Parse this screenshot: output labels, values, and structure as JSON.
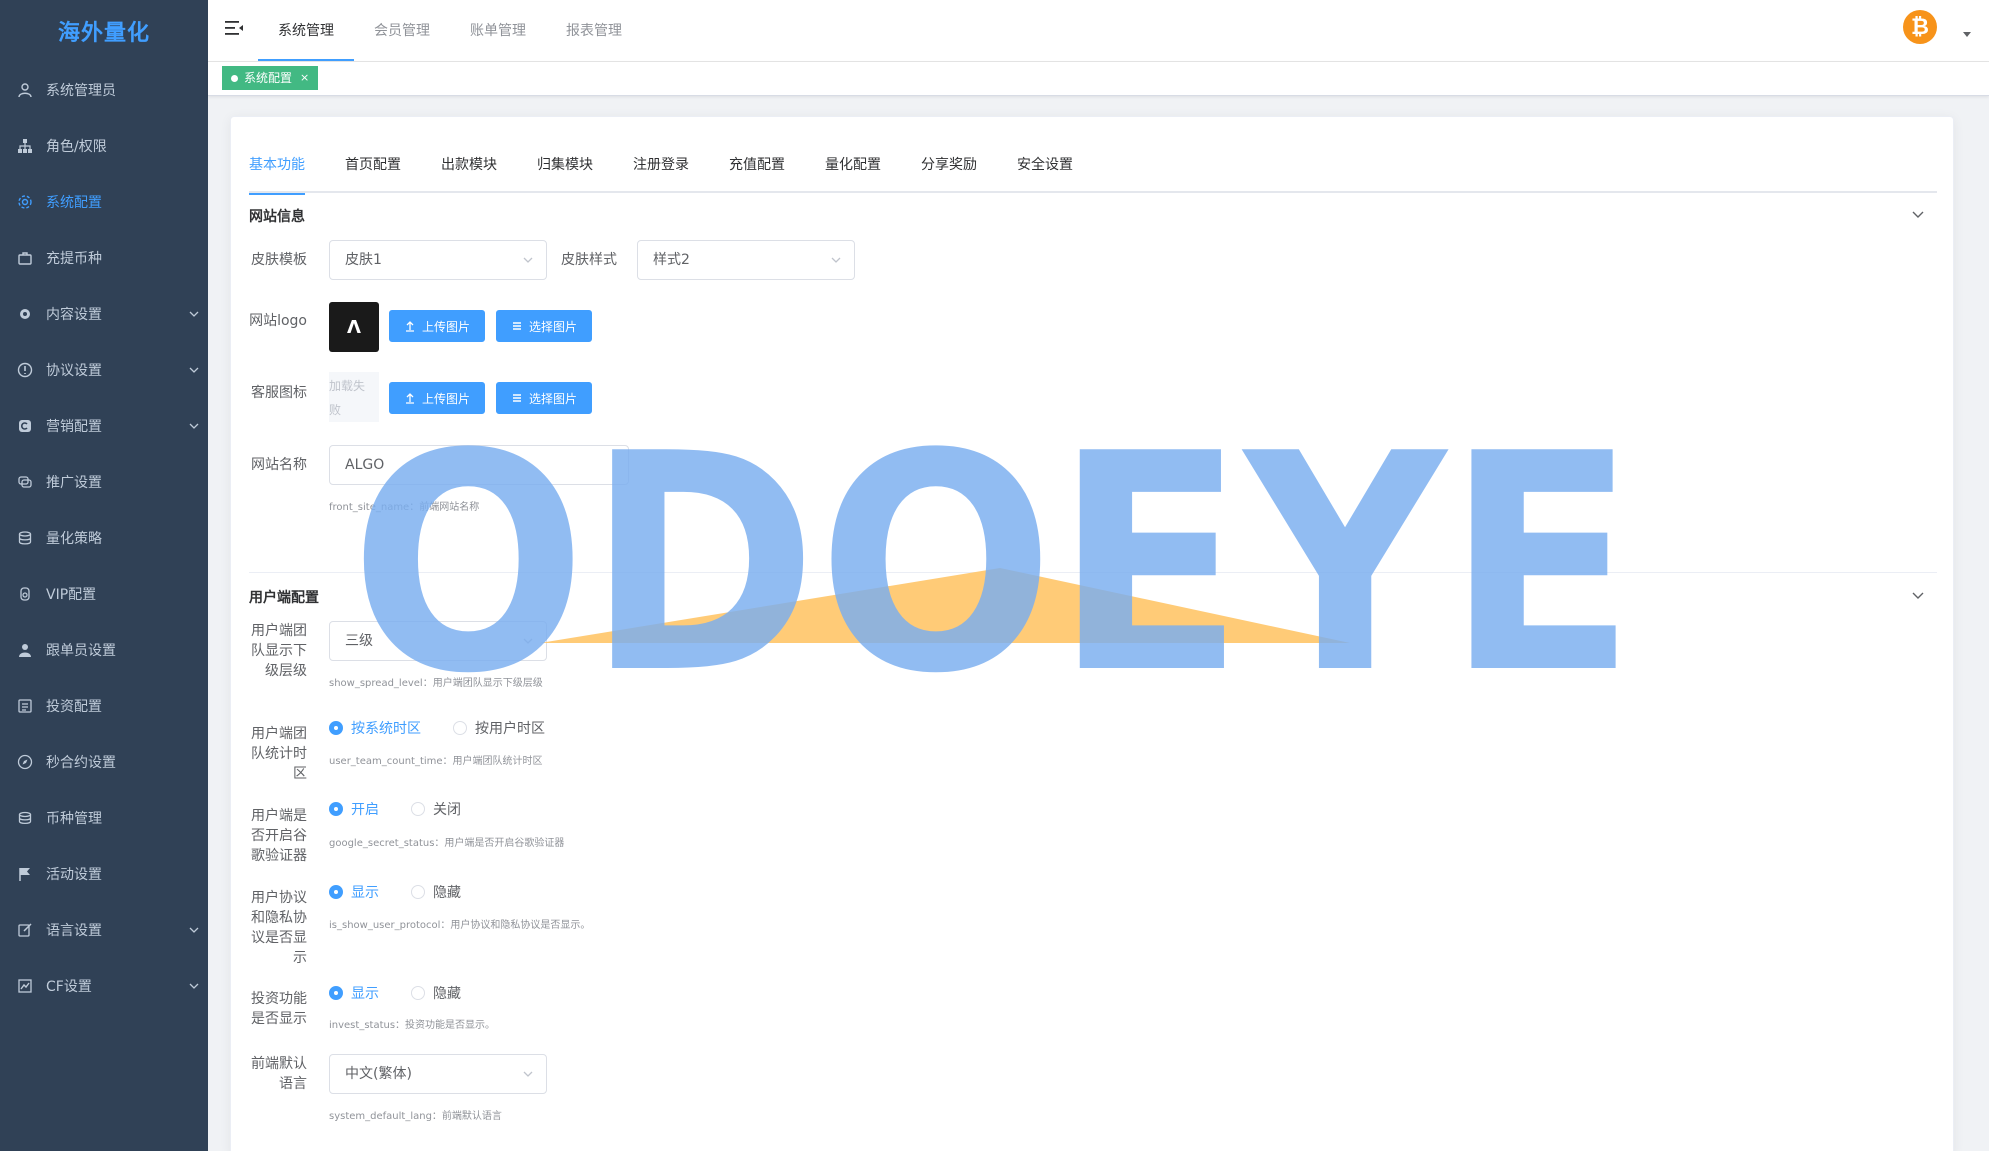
{
  "app": {
    "title": "海外量化"
  },
  "sidebar": {
    "items": [
      {
        "label": "系统管理员",
        "icon": "user-icon",
        "arrow": false,
        "active": false
      },
      {
        "label": "角色/权限",
        "icon": "sitemap-icon",
        "arrow": false,
        "active": false
      },
      {
        "label": "系统配置",
        "icon": "gear-icon",
        "arrow": false,
        "active": true
      },
      {
        "label": "充提币种",
        "icon": "briefcase-icon",
        "arrow": false,
        "active": false
      },
      {
        "label": "内容设置",
        "icon": "cog-icon",
        "arrow": true,
        "active": false
      },
      {
        "label": "协议设置",
        "icon": "info-icon",
        "arrow": true,
        "active": false
      },
      {
        "label": "营销配置",
        "icon": "marketing-icon",
        "arrow": true,
        "active": false
      },
      {
        "label": "推广设置",
        "icon": "chat-icon",
        "arrow": false,
        "active": false
      },
      {
        "label": "量化策略",
        "icon": "database-icon",
        "arrow": false,
        "active": false
      },
      {
        "label": "VIP配置",
        "icon": "medal-icon",
        "arrow": false,
        "active": false
      },
      {
        "label": "跟单员设置",
        "icon": "person-icon",
        "arrow": false,
        "active": false
      },
      {
        "label": "投资配置",
        "icon": "invest-icon",
        "arrow": false,
        "active": false
      },
      {
        "label": "秒合约设置",
        "icon": "compass-icon",
        "arrow": false,
        "active": false
      },
      {
        "label": "币种管理",
        "icon": "coins-icon",
        "arrow": false,
        "active": false
      },
      {
        "label": "活动设置",
        "icon": "flag-icon",
        "arrow": false,
        "active": false
      },
      {
        "label": "语言设置",
        "icon": "edit-icon",
        "arrow": true,
        "active": false
      },
      {
        "label": "CF设置",
        "icon": "chart-icon",
        "arrow": true,
        "active": false
      }
    ]
  },
  "header": {
    "tabs": [
      "系统管理",
      "会员管理",
      "账单管理",
      "报表管理"
    ],
    "active_tab": 0,
    "avatar_symbol": "₿",
    "avatar_color": "#f7931a"
  },
  "tags": {
    "active_label": "系统配置",
    "close": "×"
  },
  "config_tabs": [
    "基本功能",
    "首页配置",
    "出款模块",
    "归集模块",
    "注册登录",
    "充值配置",
    "量化配置",
    "分享奖励",
    "安全设置"
  ],
  "website_info": {
    "title": "网站信息",
    "skin_template_label": "皮肤模板",
    "skin_template_value": "皮肤1",
    "skin_style_label": "皮肤样式",
    "skin_style_value": "样式2",
    "logo_label": "网站logo",
    "logo_mark": "Λ",
    "upload_label": "上传图片",
    "choose_label": "选择图片",
    "service_icon_label": "客服图标",
    "service_icon_fail": [
      "加载失",
      "败"
    ],
    "site_name_label": "网站名称",
    "site_name_value": "ALGO",
    "site_name_hint": "front_site_name：前端网站名称"
  },
  "client_config": {
    "title": "用户端配置",
    "spread_level_label": [
      "用户端团",
      "队显示下",
      "级层级"
    ],
    "spread_level_value": "三级",
    "spread_level_hint": "show_spread_level：用户端团队显示下级层级",
    "count_time_label": [
      "用户端团",
      "队统计时",
      "区"
    ],
    "count_time_options": [
      "按系统时区",
      "按用户时区"
    ],
    "count_time_hint": "user_team_count_time：用户端团队统计时区",
    "google_label": [
      "用户端是",
      "否开启谷",
      "歌验证器"
    ],
    "google_options": [
      "开启",
      "关闭"
    ],
    "google_hint": "google_secret_status：用户端是否开启谷歌验证器",
    "protocol_label": [
      "用户协议",
      "和隐私协",
      "议是否显",
      "示"
    ],
    "protocol_options": [
      "显示",
      "隐藏"
    ],
    "protocol_hint": "is_show_user_protocol：用户协议和隐私协议是否显示。",
    "invest_label": [
      "投资功能",
      "是否显示"
    ],
    "invest_options": [
      "显示",
      "隐藏"
    ],
    "invest_hint": "invest_status：投资功能是否显示。",
    "lang_label": [
      "前端默认",
      "语言"
    ],
    "lang_value": "中文(繁体)",
    "lang_hint": "system_default_lang：前端默认语言"
  },
  "watermark": {
    "text": "ODOEYE"
  },
  "colors": {
    "primary": "#409eff",
    "sidebar_bg": "#304156",
    "tag_green": "#42b983"
  }
}
